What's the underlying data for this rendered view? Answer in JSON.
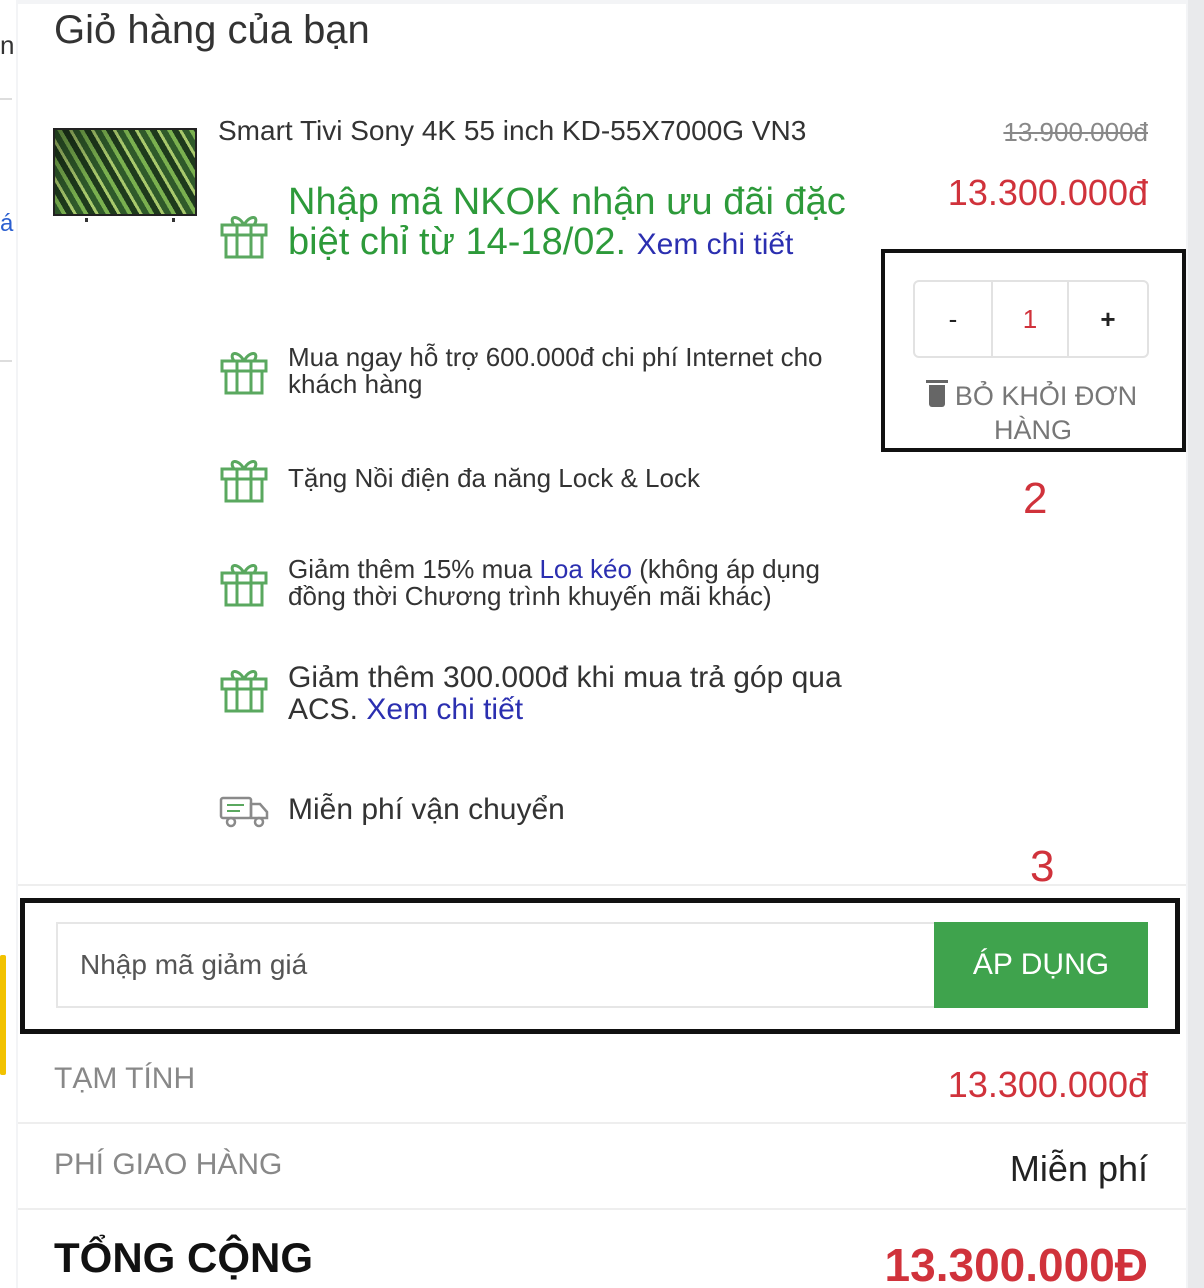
{
  "left_edge": {
    "fragment_top": "n",
    "fragment_mid": "á"
  },
  "cart": {
    "title": "Giỏ hàng của bạn",
    "product": {
      "name": "Smart Tivi Sony 4K 55 inch KD-55X7000G VN3",
      "price_old": "13.900.000đ",
      "price_new": "13.300.000đ",
      "quantity": "1",
      "minus_label": "-",
      "plus_label": "+",
      "remove_label": "BỎ KHỎI ĐƠN HÀNG"
    },
    "promotions": [
      {
        "text": "Nhập mã NKOK nhận ưu đãi đặc biệt chỉ từ 14-18/02.",
        "link": "Xem chi tiết",
        "icon": "gift-icon"
      },
      {
        "text": "Mua ngay hỗ trợ 600.000đ chi phí Internet cho khách hàng",
        "icon": "gift-icon"
      },
      {
        "text": "Tặng Nồi điện đa năng Lock & Lock",
        "icon": "gift-icon"
      },
      {
        "text_before": "Giảm thêm 15% mua",
        "link": "Loa kéo",
        "text_after": "(không áp dụng đồng thời Chương trình khuyến mãi khác)",
        "icon": "gift-icon"
      },
      {
        "text": "Giảm thêm 300.000đ khi mua trả góp qua ACS.",
        "link": "Xem chi tiết",
        "icon": "gift-icon"
      },
      {
        "text": "Miễn phí vận chuyển",
        "icon": "delivery-truck-icon"
      }
    ],
    "coupon": {
      "placeholder": "Nhập mã giảm giá",
      "apply_label": "ÁP DỤNG"
    },
    "summary": {
      "subtotal_label": "TẠM TÍNH",
      "subtotal_value": "13.300.000đ",
      "shipping_label": "PHÍ GIAO HÀNG",
      "shipping_value": "Miễn phí",
      "total_label": "TỔNG CỘNG",
      "total_value": "13.300.000Đ"
    }
  },
  "annotations": {
    "marker_2": "2",
    "marker_3": "3"
  },
  "colors": {
    "price_red": "#d0323b",
    "promo_green": "#2d9a3a",
    "button_green": "#3fa34d",
    "link_blue": "#2b2fb0"
  }
}
